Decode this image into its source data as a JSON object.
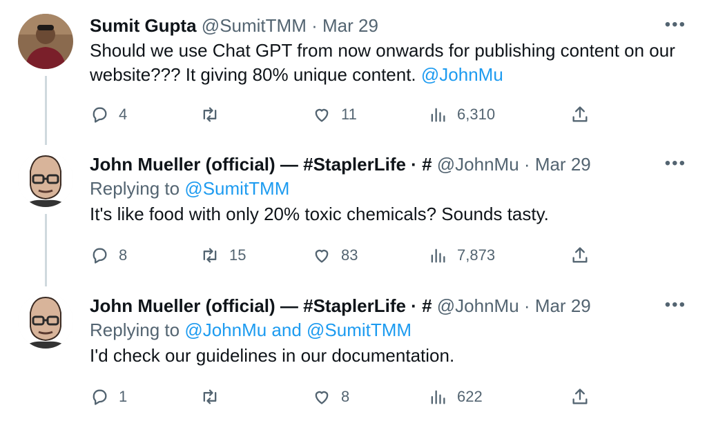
{
  "tweets": [
    {
      "name": "Sumit Gupta",
      "handle": "@SumitTMM",
      "dot": "·",
      "time": "Mar 29",
      "text_part1": "Should we use Chat GPT from now onwards for publishing content on our",
      "text_part2": "website??? It giving 80% unique content. ",
      "text_mention": "@JohnMu",
      "replies": "4",
      "retweets": "",
      "likes": "11",
      "views": "6,310"
    },
    {
      "name": "John Mueller (official) — #StaplerLife · #",
      "handle": "@JohnMu",
      "dot": "·",
      "time": "Mar 29",
      "replying_prefix": "Replying to ",
      "replying_to": "@SumitTMM",
      "text": "It's like food with only 20% toxic chemicals? Sounds tasty.",
      "replies": "8",
      "retweets": "15",
      "likes": "83",
      "views": "7,873"
    },
    {
      "name": "John Mueller (official) — #StaplerLife · #",
      "handle": "@JohnMu",
      "dot": "·",
      "time": "Mar 29",
      "replying_prefix": "Replying to ",
      "replying_to": "@JohnMu and @SumitTMM",
      "text": "I'd check our guidelines in our documentation.",
      "replies": "1",
      "retweets": "",
      "likes": "8",
      "views": "622"
    }
  ],
  "more_label": "•••",
  "icons": [
    "reply-icon",
    "retweet-icon",
    "like-icon",
    "views-icon",
    "share-icon"
  ],
  "colors": {
    "text": "#0f1419",
    "muted": "#536471",
    "link": "#1d9bf0",
    "line": "#cfd9de"
  }
}
